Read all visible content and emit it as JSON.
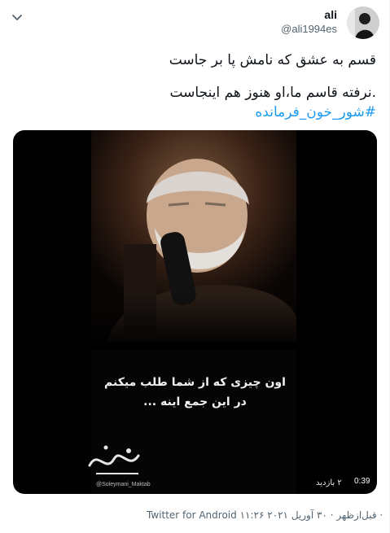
{
  "user": {
    "display_name": "ali",
    "handle": "@ali1994es"
  },
  "tweet": {
    "line1": "قسم به عشق که نامش پا بر جاست",
    "line2": ".نرفته قاسم ما،او هنوز هم اینجاست",
    "hashtag": "#شور_خون_فرمانده"
  },
  "media": {
    "caption_line1": "اون چیزی که از شما طلب میکنم",
    "caption_line2": "در این جمع اینه ...",
    "logo_text": "مکتب حاج قاسم",
    "watermark": "@Soleymani_Maktab",
    "views": "۲ بازدید",
    "duration": "0:39"
  },
  "meta": {
    "time_date": "۱۱:۲۶ قبل‌ازظهر · ۳۰ آوریل ۲۰۲۱ ·",
    "source": "Twitter for Android"
  },
  "icons": {
    "menu": "chevron-down-icon",
    "play": "video-play-icon"
  }
}
